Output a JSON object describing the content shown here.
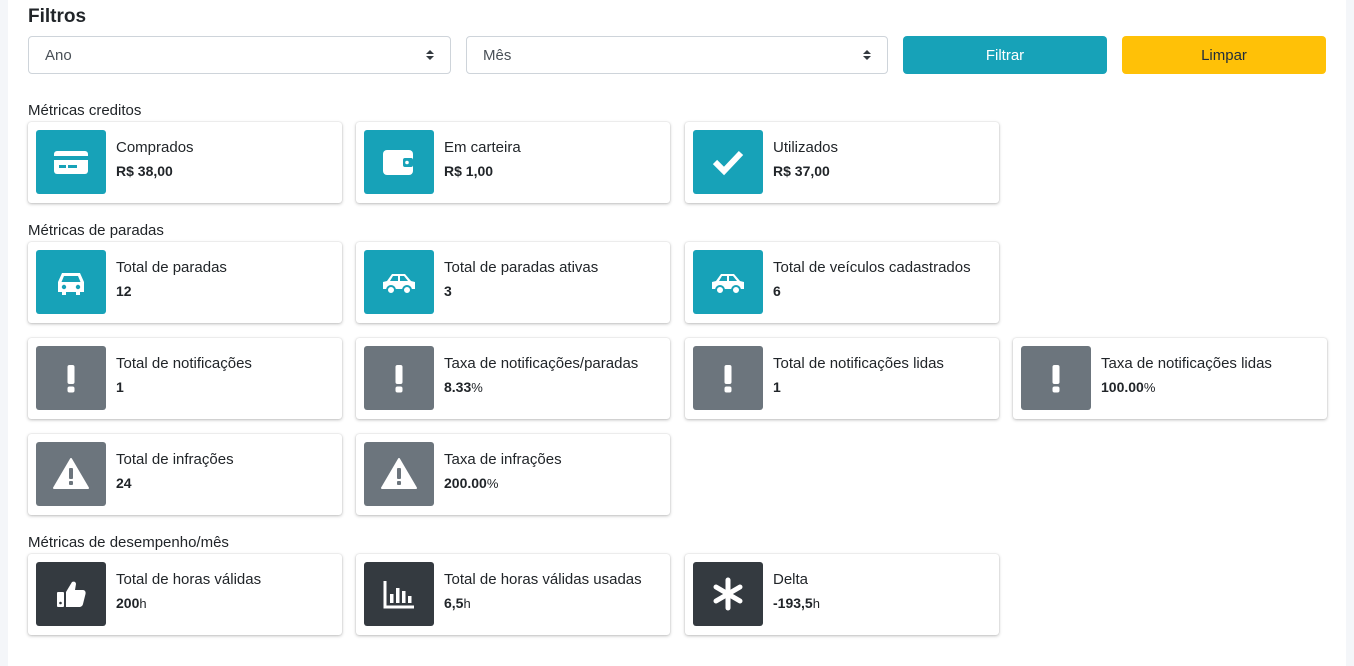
{
  "filters": {
    "title": "Filtros",
    "year_select": "Ano",
    "month_select": "Mês",
    "filter_button": "Filtrar",
    "clear_button": "Limpar"
  },
  "sections": {
    "credits": "Métricas creditos",
    "stops": "Métricas de paradas",
    "performance": "Métricas de desempenho/mês"
  },
  "cards": {
    "purchased": {
      "title": "Comprados",
      "value": "R$ 38,00",
      "icon": "credit-card-icon"
    },
    "wallet": {
      "title": "Em carteira",
      "value": "R$ 1,00",
      "icon": "wallet-icon"
    },
    "used": {
      "title": "Utilizados",
      "value": "R$ 37,00",
      "icon": "check-icon"
    },
    "total_stops": {
      "title": "Total de paradas",
      "value": "12",
      "icon": "car-icon"
    },
    "active_stops": {
      "title": "Total de paradas ativas",
      "value": "3",
      "icon": "car-side-icon"
    },
    "vehicles": {
      "title": "Total de veículos cadastrados",
      "value": "6",
      "icon": "car-side-icon"
    },
    "notifications": {
      "title": "Total de notificações",
      "value": "1",
      "icon": "exclamation-icon"
    },
    "notif_rate": {
      "title": "Taxa de notificações/paradas",
      "value": "8.33",
      "unit": "%",
      "icon": "exclamation-icon"
    },
    "notif_read": {
      "title": "Total de notificações lidas",
      "value": "1",
      "icon": "exclamation-icon"
    },
    "notif_read_rate": {
      "title": "Taxa de notificações lidas",
      "value": "100.00",
      "unit": "%",
      "icon": "exclamation-icon"
    },
    "infractions": {
      "title": "Total de infrações",
      "value": "24",
      "icon": "warning-icon"
    },
    "infraction_rate": {
      "title": "Taxa de infrações",
      "value": "200.00",
      "unit": "%",
      "icon": "warning-icon"
    },
    "valid_hours": {
      "title": "Total de horas válidas",
      "value": "200",
      "unit": "h",
      "icon": "thumbs-up-icon"
    },
    "valid_hours_used": {
      "title": "Total de horas válidas usadas",
      "value": "6,5",
      "unit": "h",
      "icon": "bar-chart-icon"
    },
    "delta": {
      "title": "Delta",
      "value": "-193,5",
      "unit": "h",
      "icon": "asterisk-icon"
    }
  },
  "colors": {
    "teal": "#17a2b8",
    "gray": "#6c757d",
    "dark": "#343a40",
    "warning": "#ffc107"
  }
}
